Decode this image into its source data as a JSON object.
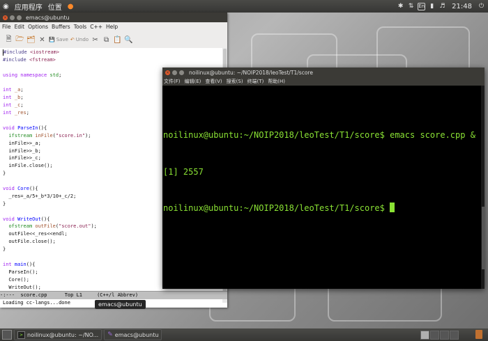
{
  "top_panel": {
    "applications": "应用程序",
    "places": "位置",
    "time": "21:48",
    "input_method": "En"
  },
  "emacs": {
    "title": "emacs@ubuntu",
    "menu": [
      "File",
      "Edit",
      "Options",
      "Buffers",
      "Tools",
      "C++",
      "Help"
    ],
    "toolbar_save": "Save",
    "toolbar_undo": "Undo",
    "modeline": "-:---  score.cpp      Top L1     (C++/l Abbrev)",
    "minibuffer": "Loading cc-langs...done",
    "code_lines": [
      "#include <iostream>",
      "#include <fstream>",
      "",
      "using namespace std;",
      "",
      "int _a;",
      "int _b;",
      "int _c;",
      "int _res;",
      "",
      "void ParseIn(){",
      "  ifstream inFile(\"score.in\");",
      "  inFile>>_a;",
      "  inFile>>_b;",
      "  inFile>>_c;",
      "  inFile.close();",
      "}",
      "",
      "void Core(){",
      "  _res=_a/5+_b*3/10+_c/2;",
      "}",
      "",
      "void WriteOut(){",
      "  ofstream outFile(\"score.out\");",
      "  outFile<<_res<<endl;",
      "  outFile.close();",
      "}",
      "",
      "int main(){",
      "  ParseIn();",
      "  Core();",
      "  WriteOut();"
    ]
  },
  "terminal": {
    "title": "noilinux@ubuntu: ~/NOIP2018/leoTest/T1/score",
    "menu": [
      "文件(F)",
      "编辑(E)",
      "查看(V)",
      "搜索(S)",
      "终端(T)",
      "帮助(H)"
    ],
    "lines": [
      "noilinux@ubuntu:~/NOIP2018/leoTest/T1/score$ emacs score.cpp &",
      "[1] 2557",
      "noilinux@ubuntu:~/NOIP2018/leoTest/T1/score$ "
    ]
  },
  "tooltip": "emacs@ubuntu",
  "taskbar": [
    {
      "label": "noilinux@ubuntu: ~/NO..."
    },
    {
      "label": "emacs@ubuntu"
    }
  ]
}
